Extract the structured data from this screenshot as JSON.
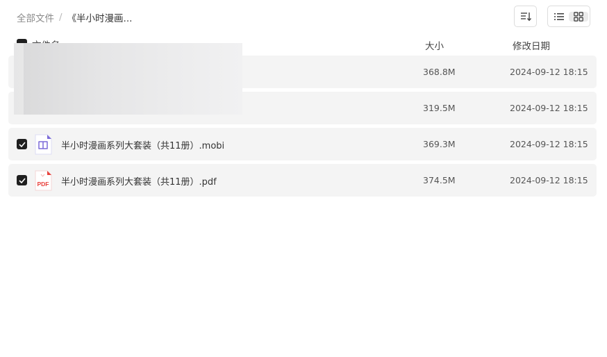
{
  "breadcrumb": {
    "root": "全部文件",
    "separator": "/",
    "current": "《半小时漫画..."
  },
  "toolbar": {
    "sort_icon": "sort-icon",
    "list_view_icon": "list-view-icon",
    "grid_view_icon": "grid-view-icon",
    "active_view": "list"
  },
  "header": {
    "name": "文件名",
    "size": "大小",
    "date": "修改日期",
    "all_checked": true
  },
  "files": [
    {
      "name": "",
      "size": "368.8M",
      "date": "2024-09-12 18:15",
      "checked": true
    },
    {
      "name": "",
      "size": "319.5M",
      "date": "2024-09-12 18:15",
      "checked": true
    },
    {
      "name": "半小时漫画系列大套装（共11册）.mobi",
      "size": "369.3M",
      "date": "2024-09-12 18:15",
      "checked": true,
      "icon": "mobi-file-icon",
      "icon_color": "#7b6ad8"
    },
    {
      "name": "半小时漫画系列大套装（共11册）.pdf",
      "size": "374.5M",
      "date": "2024-09-12 18:15",
      "checked": true,
      "icon": "pdf-file-icon",
      "icon_color": "#e8413c",
      "icon_label": "PDF"
    }
  ]
}
